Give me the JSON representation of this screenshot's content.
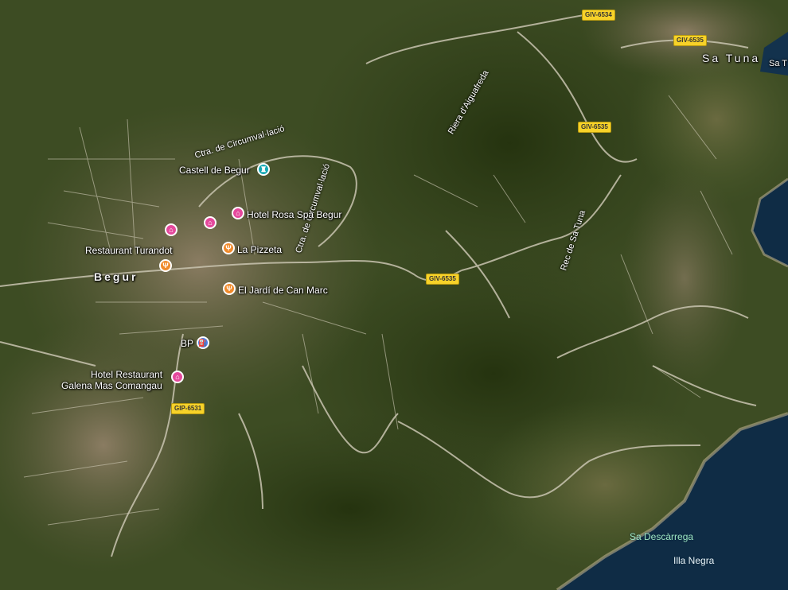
{
  "places": {
    "begur": "Begur",
    "sa_tuna": "Sa Tuna",
    "sa_tuna_edge": "Sa T",
    "sa_descarrega": "Sa Descàrrega",
    "illa_negra": "Illa Negra"
  },
  "roads": {
    "circumvallacio_1": "Ctra. de Circumval·lació",
    "circumvallacio_2": "Ctra. de Circumval·lació",
    "riera": "Riera d'Aiguafreda",
    "rec": "Rec de Sa Tuna"
  },
  "shields": {
    "giv6534": "GIV-6534",
    "giv6535_a": "GIV-6535",
    "giv6535_b": "GIV-6535",
    "giv6535_c": "GIV-6535",
    "gip6531": "GIP-6531"
  },
  "pois": {
    "castell": "Castell de Begur",
    "hotel_rosa": "Hotel Rosa Spa Begur",
    "turandot": "Restaurant Turandot",
    "pizzeta": "La Pizzeta",
    "can_marc": "El Jardí de Can Marc",
    "bp": "BP",
    "hotel_galena_1": "Hotel Restaurant",
    "hotel_galena_2": "Galena Mas Comangau"
  },
  "icons": {
    "hotel": "bed-icon",
    "food": "fork-knife-icon",
    "castle": "monument-icon",
    "fuel": "fuel-icon"
  },
  "colors": {
    "land": "#3d4c23",
    "forest": "#2e3d18",
    "sea": "#0f2c45",
    "shield": "#f7d229",
    "hotel_pin": "#e5489c",
    "food_pin": "#f08a2b",
    "castle_pin": "#13a7b3",
    "fuel_pin": "#4a7ee8"
  }
}
